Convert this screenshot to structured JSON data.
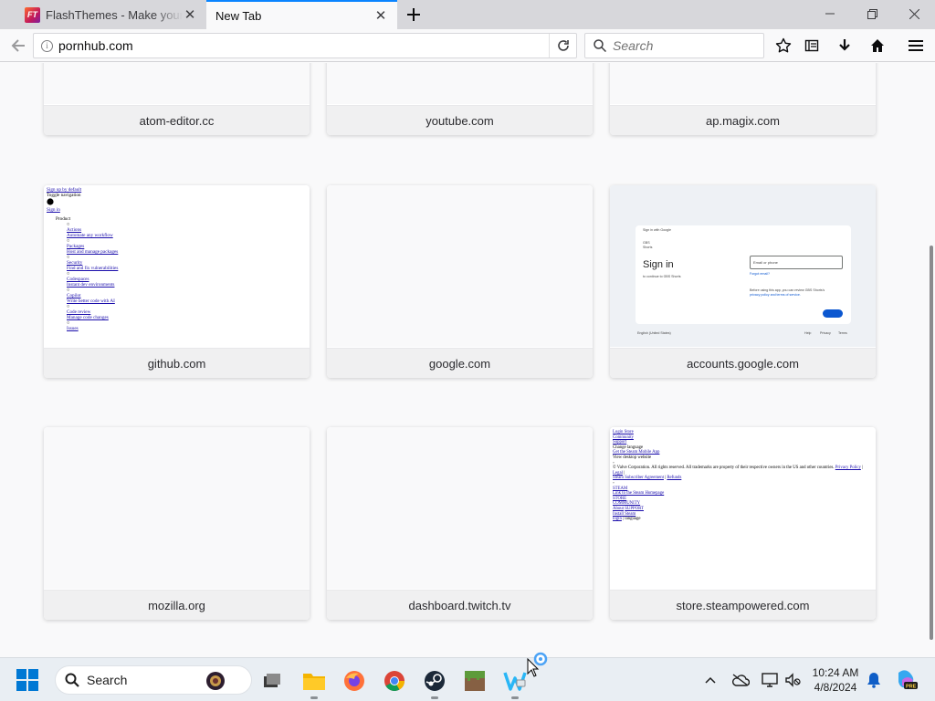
{
  "browser": {
    "tabs": [
      {
        "title": "FlashThemes - Make your o",
        "favicon": "FT",
        "active": false
      },
      {
        "title": "New Tab",
        "active": true
      }
    ],
    "url": "pornhub.com",
    "search_placeholder": "Search"
  },
  "top_sites": {
    "rows": [
      [
        {
          "label": "atom-editor.cc",
          "thumb": "blank"
        },
        {
          "label": "youtube.com",
          "thumb": "blank"
        },
        {
          "label": "ap.magix.com",
          "thumb": "blank"
        }
      ],
      [
        {
          "label": "github.com",
          "thumb": "github"
        },
        {
          "label": "google.com",
          "thumb": "blank"
        },
        {
          "label": "accounts.google.com",
          "thumb": "google"
        }
      ],
      [
        {
          "label": "mozilla.org",
          "thumb": "blank"
        },
        {
          "label": "dashboard.twitch.tv",
          "thumb": "blank"
        },
        {
          "label": "store.steampowered.com",
          "thumb": "steam"
        }
      ]
    ],
    "github_thumb": {
      "signup": "Sign up by default",
      "toggle": "Toggle navigation",
      "signin": "Sign in",
      "product": "Product",
      "items": [
        {
          "name": "Actions",
          "desc": "Automate any workflow"
        },
        {
          "name": "Packages",
          "desc": "Host and manage packages"
        },
        {
          "name": "Security",
          "desc": "Find and fix vulnerabilities"
        },
        {
          "name": "Codespaces",
          "desc": "Instant dev environments"
        },
        {
          "name": "Copilot",
          "desc": "Write better code with AI"
        },
        {
          "name": "Code review",
          "desc": "Manage code changes"
        },
        {
          "name": "Issues",
          "desc": ""
        }
      ]
    },
    "google_thumb": {
      "header": "Sign in with Google",
      "brand": "GBS",
      "sub": "Shorts",
      "title": "Sign in",
      "continue": "to continue to GBS Shorts",
      "email_placeholder": "Email or phone",
      "forgot": "Forgot email?",
      "notice": "Before using this app, you can review GBS Shorts's",
      "policy": "privacy policy and terms of service.",
      "next": "Next",
      "lang": "English (United States)",
      "help": "Help",
      "privacy": "Privacy",
      "terms": "Terms"
    },
    "steam_thumb": {
      "lines_top": [
        "Login Store",
        "Community",
        "Support",
        "Change language",
        "Get the Steam Mobile App",
        "View desktop website"
      ],
      "copyright": "© Valve Corporation. All rights reserved. All trademarks are property of their respective owners in the US and other countries.",
      "privacy": "Privacy Policy",
      "legal": "Legal",
      "ssa": "Steam Subscriber Agreement",
      "refunds": "Refunds",
      "lines_bottom": [
        "STEAM",
        "Link to the Steam Homepage",
        "STORE",
        "COMMUNITY",
        "About",
        "SUPPORT",
        "Install Steam",
        "login",
        "language"
      ]
    }
  },
  "taskbar": {
    "search_label": "Search",
    "clock_time": "10:24 AM",
    "clock_date": "4/8/2024"
  },
  "colors": {
    "accent": "#0a84ff",
    "tab_strip": "#d7d7db",
    "page_bg": "#f9f9fa",
    "taskbar_bg": "#e9eef3"
  }
}
